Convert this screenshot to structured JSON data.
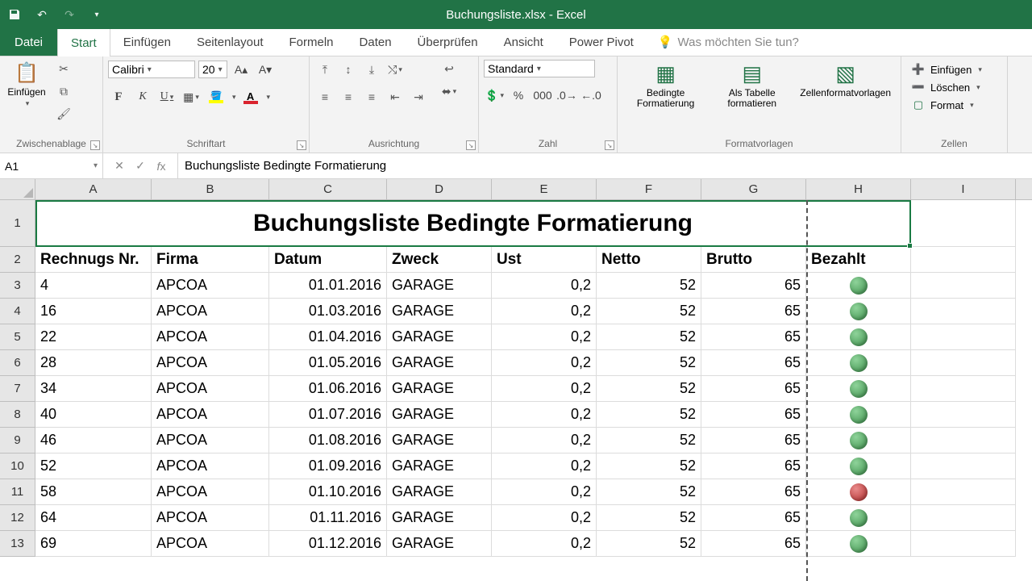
{
  "titlebar": {
    "title": "Buchungsliste.xlsx - Excel"
  },
  "tabs": {
    "file": "Datei",
    "items": [
      "Start",
      "Einfügen",
      "Seitenlayout",
      "Formeln",
      "Daten",
      "Überprüfen",
      "Ansicht",
      "Power Pivot"
    ],
    "active_index": 0,
    "tellme": "Was möchten Sie tun?"
  },
  "ribbon": {
    "clipboard": {
      "paste": "Einfügen",
      "label": "Zwischenablage"
    },
    "font": {
      "name": "Calibri",
      "size": "20",
      "label": "Schriftart"
    },
    "alignment": {
      "label": "Ausrichtung"
    },
    "number": {
      "format": "Standard",
      "label": "Zahl"
    },
    "styles": {
      "cond": "Bedingte Formatierung",
      "table": "Als Tabelle formatieren",
      "cellstyles": "Zellenformatvorlagen",
      "label": "Formatvorlagen"
    },
    "cells": {
      "insert": "Einfügen",
      "delete": "Löschen",
      "format": "Format",
      "label": "Zellen"
    }
  },
  "fx": {
    "cellref": "A1",
    "formula": "Buchungsliste Bedingte Formatierung"
  },
  "columns": [
    "A",
    "B",
    "C",
    "D",
    "E",
    "F",
    "G",
    "H",
    "I"
  ],
  "sheet": {
    "title": "Buchungsliste Bedingte Formatierung",
    "headers": [
      "Rechnugs Nr.",
      "Firma",
      "Datum",
      "Zweck",
      "Ust",
      "Netto",
      "Brutto",
      "Bezahlt"
    ],
    "rows": [
      {
        "nr": "4",
        "firma": "APCOA",
        "datum": "01.01.2016",
        "zweck": "GARAGE",
        "ust": "0,2",
        "netto": "52",
        "brutto": "65",
        "status": "green"
      },
      {
        "nr": "16",
        "firma": "APCOA",
        "datum": "01.03.2016",
        "zweck": "GARAGE",
        "ust": "0,2",
        "netto": "52",
        "brutto": "65",
        "status": "green"
      },
      {
        "nr": "22",
        "firma": "APCOA",
        "datum": "01.04.2016",
        "zweck": "GARAGE",
        "ust": "0,2",
        "netto": "52",
        "brutto": "65",
        "status": "green"
      },
      {
        "nr": "28",
        "firma": "APCOA",
        "datum": "01.05.2016",
        "zweck": "GARAGE",
        "ust": "0,2",
        "netto": "52",
        "brutto": "65",
        "status": "green"
      },
      {
        "nr": "34",
        "firma": "APCOA",
        "datum": "01.06.2016",
        "zweck": "GARAGE",
        "ust": "0,2",
        "netto": "52",
        "brutto": "65",
        "status": "green"
      },
      {
        "nr": "40",
        "firma": "APCOA",
        "datum": "01.07.2016",
        "zweck": "GARAGE",
        "ust": "0,2",
        "netto": "52",
        "brutto": "65",
        "status": "green"
      },
      {
        "nr": "46",
        "firma": "APCOA",
        "datum": "01.08.2016",
        "zweck": "GARAGE",
        "ust": "0,2",
        "netto": "52",
        "brutto": "65",
        "status": "green"
      },
      {
        "nr": "52",
        "firma": "APCOA",
        "datum": "01.09.2016",
        "zweck": "GARAGE",
        "ust": "0,2",
        "netto": "52",
        "brutto": "65",
        "status": "green"
      },
      {
        "nr": "58",
        "firma": "APCOA",
        "datum": "01.10.2016",
        "zweck": "GARAGE",
        "ust": "0,2",
        "netto": "52",
        "brutto": "65",
        "status": "red"
      },
      {
        "nr": "64",
        "firma": "APCOA",
        "datum": "01.11.2016",
        "zweck": "GARAGE",
        "ust": "0,2",
        "netto": "52",
        "brutto": "65",
        "status": "green"
      },
      {
        "nr": "69",
        "firma": "APCOA",
        "datum": "01.12.2016",
        "zweck": "GARAGE",
        "ust": "0,2",
        "netto": "52",
        "brutto": "65",
        "status": "green"
      }
    ]
  }
}
